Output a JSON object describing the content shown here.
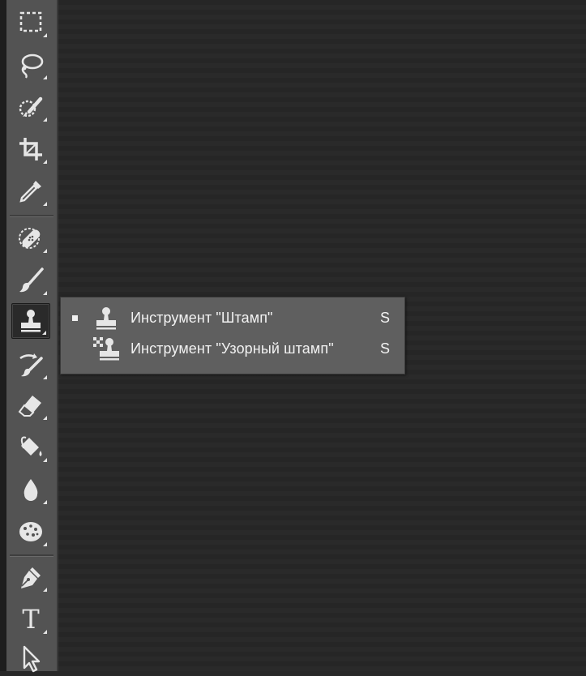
{
  "toolbar": {
    "tools": [
      {
        "name": "rectangular-marquee",
        "icon": "marquee-icon"
      },
      {
        "name": "lasso",
        "icon": "lasso-icon"
      },
      {
        "name": "quick-selection",
        "icon": "quick-selection-icon"
      },
      {
        "name": "crop",
        "icon": "crop-icon"
      },
      {
        "name": "eyedropper",
        "icon": "eyedropper-icon"
      },
      {
        "name": "spot-healing",
        "icon": "bandage-icon"
      },
      {
        "name": "brush",
        "icon": "brush-icon"
      },
      {
        "name": "clone-stamp",
        "icon": "stamp-icon",
        "active": true
      },
      {
        "name": "history-brush",
        "icon": "history-brush-icon"
      },
      {
        "name": "eraser",
        "icon": "eraser-icon"
      },
      {
        "name": "paint-bucket",
        "icon": "bucket-icon"
      },
      {
        "name": "blur",
        "icon": "drop-icon"
      },
      {
        "name": "sponge",
        "icon": "sponge-icon"
      },
      {
        "name": "pen",
        "icon": "pen-icon"
      },
      {
        "name": "type",
        "icon": "type-icon",
        "glyph": "T"
      },
      {
        "name": "move-selection",
        "icon": "arrow-icon"
      }
    ]
  },
  "flyout": {
    "items": [
      {
        "label": "Инструмент \"Штамп\"",
        "shortcut": "S",
        "selected": true,
        "icon": "stamp-icon"
      },
      {
        "label": "Инструмент \"Узорный штамп\"",
        "shortcut": "S",
        "selected": false,
        "icon": "pattern-stamp-icon"
      }
    ]
  },
  "colors": {
    "toolbar_bg": "#535353",
    "canvas_bg": "#282828",
    "flyout_bg": "#5f5f5f",
    "icon": "#e6e6e6"
  }
}
